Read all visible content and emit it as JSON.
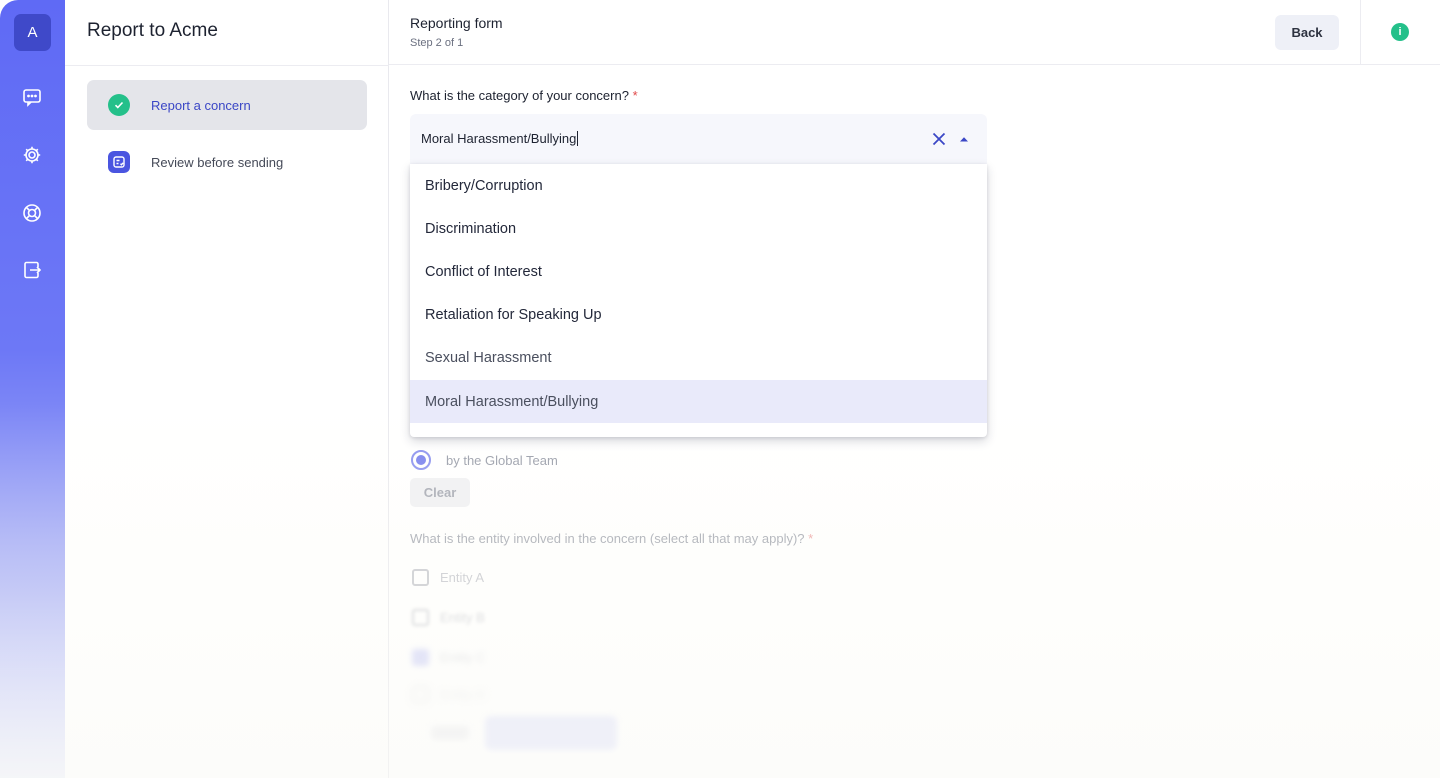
{
  "rail": {
    "avatar_letter": "A",
    "icons": [
      "chat-icon",
      "gear-icon",
      "help-lifebuoy-icon",
      "logout-icon"
    ]
  },
  "steps_panel": {
    "title": "Report to Acme",
    "steps": [
      {
        "label": "Report a concern",
        "state": "completed",
        "icon": "check-circle-icon"
      },
      {
        "label": "Review before sending",
        "state": "pending",
        "icon": "checklist-icon"
      }
    ]
  },
  "header": {
    "title": "Reporting form",
    "subtitle": "Step 2 of 1",
    "back_label": "Back",
    "info_icon": "info-icon"
  },
  "form": {
    "category_question": "What is the category of your concern?",
    "required_mark": "*",
    "category_value": "Moral Harassment/Bullying",
    "category_options": [
      "Bribery/Corruption",
      "Discrimination",
      "Conflict of Interest",
      "Retaliation for Speaking Up",
      "Sexual Harassment",
      "Moral Harassment/Bullying"
    ],
    "selected_option_index": 5,
    "radio_label": "by the Global Team",
    "clear_label": "Clear",
    "entity_question": "What is the entity involved in the concern (select all that may apply)?",
    "entities": [
      {
        "label": "Entity A",
        "checked": false
      },
      {
        "label": "Entity B",
        "checked": false
      },
      {
        "label": "Entity C",
        "checked": true
      },
      {
        "label": "Entity D",
        "checked": false
      }
    ]
  },
  "colors": {
    "accent": "#3b47c6",
    "rail_top": "#5f6af5",
    "success": "#24c08a",
    "required": "#e04848",
    "selected_option_bg": "#e9eafa"
  }
}
